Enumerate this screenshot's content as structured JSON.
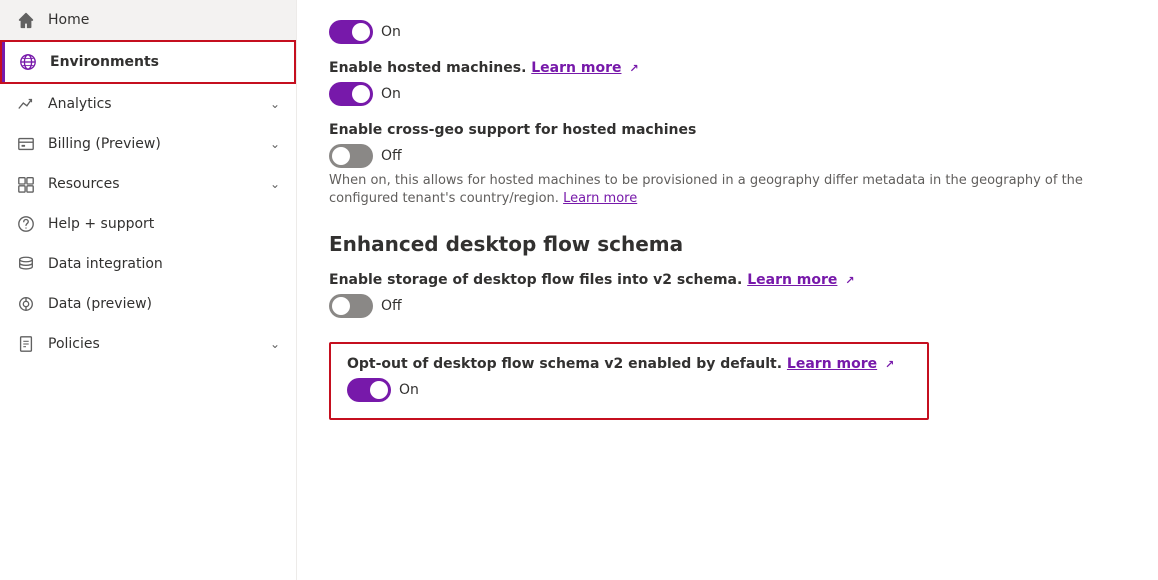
{
  "sidebar": {
    "items": [
      {
        "id": "home",
        "label": "Home",
        "icon": "home",
        "active": false,
        "hasChevron": false
      },
      {
        "id": "environments",
        "label": "Environments",
        "icon": "globe",
        "active": true,
        "hasChevron": false
      },
      {
        "id": "analytics",
        "label": "Analytics",
        "icon": "chart",
        "active": false,
        "hasChevron": true
      },
      {
        "id": "billing",
        "label": "Billing (Preview)",
        "icon": "billing",
        "active": false,
        "hasChevron": true
      },
      {
        "id": "resources",
        "label": "Resources",
        "icon": "resources",
        "active": false,
        "hasChevron": true
      },
      {
        "id": "help",
        "label": "Help + support",
        "icon": "help",
        "active": false,
        "hasChevron": false
      },
      {
        "id": "data-integration",
        "label": "Data integration",
        "icon": "data-integration",
        "active": false,
        "hasChevron": false
      },
      {
        "id": "data-preview",
        "label": "Data (preview)",
        "icon": "data-preview",
        "active": false,
        "hasChevron": false
      },
      {
        "id": "policies",
        "label": "Policies",
        "icon": "policies",
        "active": false,
        "hasChevron": true
      }
    ]
  },
  "main": {
    "toggle1": {
      "state": "on",
      "label": "On"
    },
    "hosted_machines": {
      "label_text": "Enable hosted machines.",
      "learn_more": "Learn more",
      "toggle_state": "on",
      "toggle_label": "On"
    },
    "cross_geo": {
      "label_text": "Enable cross-geo support for hosted machines",
      "toggle_state": "off",
      "toggle_label": "Off",
      "description": "When on, this allows for hosted machines to be provisioned in a geography differ metadata in the geography of the configured tenant's country/region.",
      "learn_more": "Learn more"
    },
    "section_heading": "Enhanced desktop flow schema",
    "storage_schema": {
      "label_text": "Enable storage of desktop flow files into v2 schema.",
      "learn_more": "Learn more",
      "toggle_state": "off",
      "toggle_label": "Off"
    },
    "opt_out": {
      "label_text": "Opt-out of desktop flow schema v2 enabled by default.",
      "learn_more": "Learn more",
      "toggle_state": "on",
      "toggle_label": "On"
    }
  }
}
